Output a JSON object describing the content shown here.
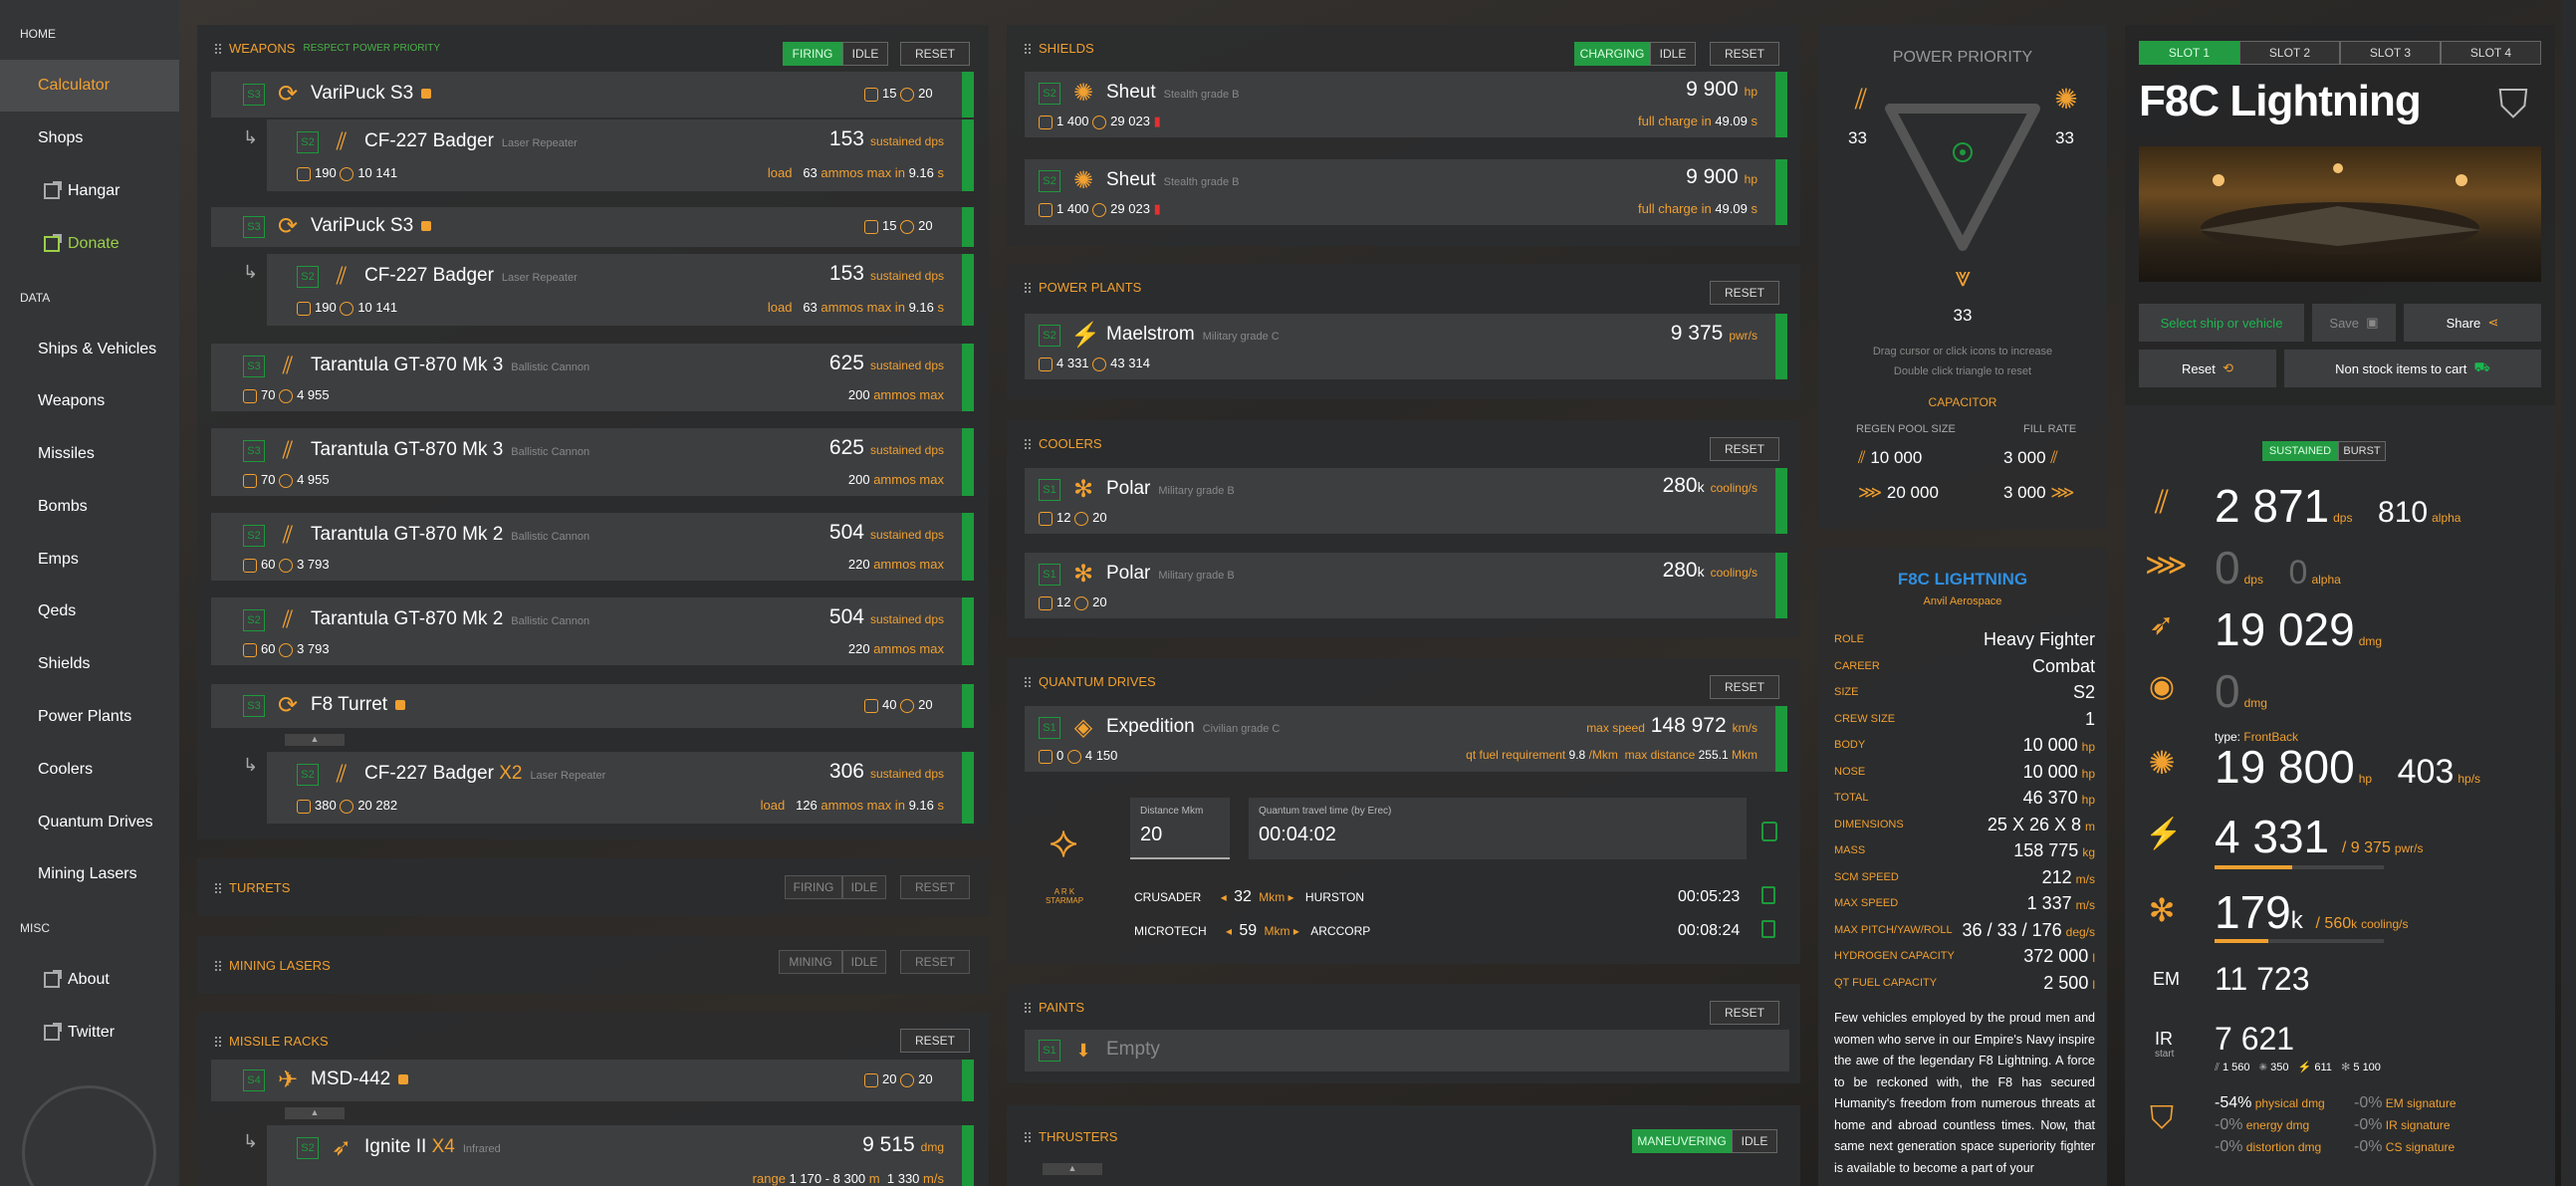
{
  "sidebar": {
    "home_section": "HOME",
    "data_section": "DATA",
    "misc_section": "MISC",
    "items": [
      {
        "label": "Calculator"
      },
      {
        "label": "Shops"
      },
      {
        "label": "Hangar"
      },
      {
        "label": "Donate"
      },
      {
        "label": "Ships & Vehicles"
      },
      {
        "label": "Weapons"
      },
      {
        "label": "Missiles"
      },
      {
        "label": "Bombs"
      },
      {
        "label": "Emps"
      },
      {
        "label": "Qeds"
      },
      {
        "label": "Shields"
      },
      {
        "label": "Power Plants"
      },
      {
        "label": "Coolers"
      },
      {
        "label": "Quantum Drives"
      },
      {
        "label": "Mining Lasers"
      },
      {
        "label": "About"
      },
      {
        "label": "Twitter"
      }
    ]
  },
  "weapons": {
    "title": "WEAPONS",
    "subtitle": "RESPECT POWER PRIORITY",
    "firing": "FIRING",
    "idle": "IDLE",
    "reset": "RESET",
    "rows": [
      {
        "slot": "S3",
        "name": "VariPuck S3",
        "type": "",
        "p1": "15",
        "p2": "20"
      },
      {
        "slot": "S2",
        "name": "CF-227 Badger",
        "type": "Laser Repeater",
        "value": "153",
        "unit": "sustained dps",
        "p1": "190",
        "p2": "10 141",
        "sub_a": "load",
        "sub_b": "63",
        "sub_c": "ammos max in",
        "sub_d": "9.16",
        "sub_e": "s"
      },
      {
        "slot": "S3",
        "name": "VariPuck S3",
        "type": "",
        "p1": "15",
        "p2": "20"
      },
      {
        "slot": "S2",
        "name": "CF-227 Badger",
        "type": "Laser Repeater",
        "value": "153",
        "unit": "sustained dps",
        "p1": "190",
        "p2": "10 141",
        "sub_a": "load",
        "sub_b": "63",
        "sub_c": "ammos max in",
        "sub_d": "9.16",
        "sub_e": "s"
      },
      {
        "slot": "S3",
        "name": "Tarantula GT-870 Mk 3",
        "type": "Ballistic Cannon",
        "value": "625",
        "unit": "sustained dps",
        "p1": "70",
        "p2": "4 955",
        "sub_b": "200",
        "sub_c": "ammos max"
      },
      {
        "slot": "S3",
        "name": "Tarantula GT-870 Mk 3",
        "type": "Ballistic Cannon",
        "value": "625",
        "unit": "sustained dps",
        "p1": "70",
        "p2": "4 955",
        "sub_b": "200",
        "sub_c": "ammos max"
      },
      {
        "slot": "S2",
        "name": "Tarantula GT-870 Mk 2",
        "type": "Ballistic Cannon",
        "value": "504",
        "unit": "sustained dps",
        "p1": "60",
        "p2": "3 793",
        "sub_b": "220",
        "sub_c": "ammos max"
      },
      {
        "slot": "S2",
        "name": "Tarantula GT-870 Mk 2",
        "type": "Ballistic Cannon",
        "value": "504",
        "unit": "sustained dps",
        "p1": "60",
        "p2": "3 793",
        "sub_b": "220",
        "sub_c": "ammos max"
      },
      {
        "slot": "S3",
        "name": "F8 Turret",
        "type": "",
        "p1": "40",
        "p2": "20"
      },
      {
        "slot": "S2",
        "name": "CF-227 Badger",
        "mult": "X2",
        "type": "Laser Repeater",
        "value": "306",
        "unit": "sustained dps",
        "p1": "380",
        "p2": "20 282",
        "sub_a": "load",
        "sub_b": "126",
        "sub_c": "ammos max in",
        "sub_d": "9.16",
        "sub_e": "s"
      }
    ]
  },
  "turrets": {
    "title": "TURRETS",
    "firing": "FIRING",
    "idle": "IDLE",
    "reset": "RESET"
  },
  "mining": {
    "title": "MINING LASERS",
    "mining": "MINING",
    "idle": "IDLE",
    "reset": "RESET"
  },
  "missiles": {
    "title": "MISSILE RACKS",
    "reset": "RESET",
    "rack": {
      "slot": "S4",
      "name": "MSD-442",
      "p1": "20",
      "p2": "20"
    },
    "missile": {
      "slot": "S2",
      "name": "Ignite II",
      "mult": "X4",
      "type": "Infrared",
      "value": "9 515",
      "unit": "dmg",
      "range_lbl": "range",
      "range": "1 170 - 8 300",
      "range_u": "m",
      "speed": "1 330",
      "speed_u": "m/s"
    }
  },
  "shields": {
    "title": "SHIELDS",
    "charging": "CHARGING",
    "idle": "IDLE",
    "reset": "RESET",
    "rows": [
      {
        "slot": "S2",
        "name": "Sheut",
        "type": "Stealth grade B",
        "value": "9 900",
        "unit": "hp",
        "p1": "1 400",
        "p2": "29 023",
        "sub_a": "full charge in",
        "sub_b": "49.09",
        "sub_c": "s"
      },
      {
        "slot": "S2",
        "name": "Sheut",
        "type": "Stealth grade B",
        "value": "9 900",
        "unit": "hp",
        "p1": "1 400",
        "p2": "29 023",
        "sub_a": "full charge in",
        "sub_b": "49.09",
        "sub_c": "s"
      }
    ]
  },
  "power_plants": {
    "title": "POWER PLANTS",
    "reset": "RESET",
    "row": {
      "slot": "S2",
      "name": "Maelstrom",
      "type": "Military grade C",
      "value": "9 375",
      "unit": "pwr/s",
      "p1": "4 331",
      "p2": "43 314"
    }
  },
  "coolers": {
    "title": "COOLERS",
    "reset": "RESET",
    "rows": [
      {
        "slot": "S1",
        "name": "Polar",
        "type": "Military grade B",
        "value": "280",
        "vk": "k",
        "unit": "cooling/s",
        "p1": "12",
        "p2": "20"
      },
      {
        "slot": "S1",
        "name": "Polar",
        "type": "Military grade B",
        "value": "280",
        "vk": "k",
        "unit": "cooling/s",
        "p1": "12",
        "p2": "20"
      }
    ]
  },
  "quantum": {
    "title": "QUANTUM DRIVES",
    "reset": "RESET",
    "row": {
      "slot": "S1",
      "name": "Expedition",
      "type": "Civilian grade C",
      "max_speed_lbl": "max speed",
      "max_speed": "148 972",
      "max_speed_u": "km/s",
      "p1": "0",
      "p2": "4 150",
      "fuel_lbl": "qt fuel requirement",
      "fuel": "9.8",
      "fuel_u": "/Mkm",
      "dist_lbl": "max distance",
      "dist": "255.1",
      "dist_u": "Mkm"
    },
    "distance_label": "Distance Mkm",
    "distance_value": "20",
    "travel_label": "Quantum travel time (by Erec)",
    "travel_value": "00:04:02",
    "logo_text": "A R K\nSTARMAP",
    "routes": [
      {
        "from": "CRUSADER",
        "dist": "32",
        "unit": "Mkm",
        "to": "HURSTON",
        "time": "00:05:23"
      },
      {
        "from": "MICROTECH",
        "dist": "59",
        "unit": "Mkm",
        "to": "ARCCORP",
        "time": "00:08:24"
      }
    ]
  },
  "paints": {
    "title": "PAINTS",
    "reset": "RESET",
    "row": {
      "slot": "S1",
      "name": "Empty"
    }
  },
  "thrusters": {
    "title": "THRUSTERS",
    "maneuvering": "MANEUVERING",
    "idle": "IDLE"
  },
  "power_priority": {
    "title": "POWER PRIORITY",
    "weapons": "33",
    "shields": "33",
    "engines": "33",
    "hint1": "Drag cursor or click icons to increase",
    "hint2": "Double click triangle to reset",
    "capacitor": "CAPACITOR",
    "regen_lbl": "REGEN POOL SIZE",
    "fill_lbl": "FILL RATE",
    "cap_rows": [
      {
        "regen": "10 000",
        "fill": "3 000"
      },
      {
        "regen": "20 000",
        "fill": "3 000"
      }
    ]
  },
  "ship_info": {
    "name": "F8C LIGHTNING",
    "maker": "Anvil Aerospace",
    "stats": [
      {
        "label": "ROLE",
        "value": "Heavy Fighter",
        "unit": ""
      },
      {
        "label": "CAREER",
        "value": "Combat",
        "unit": ""
      },
      {
        "label": "SIZE",
        "value": "S2",
        "unit": ""
      },
      {
        "label": "CREW SIZE",
        "value": "1",
        "unit": ""
      },
      {
        "label": "BODY",
        "value": "10 000",
        "unit": "hp"
      },
      {
        "label": "NOSE",
        "value": "10 000",
        "unit": "hp"
      },
      {
        "label": "TOTAL",
        "value": "46 370",
        "unit": "hp"
      },
      {
        "label": "DIMENSIONS",
        "value": "25 X 26 X 8",
        "unit": "m"
      },
      {
        "label": "MASS",
        "value": "158 775",
        "unit": "kg"
      },
      {
        "label": "SCM SPEED",
        "value": "212",
        "unit": "m/s"
      },
      {
        "label": "MAX SPEED",
        "value": "1 337",
        "unit": "m/s"
      },
      {
        "label": "MAX PITCH/YAW/ROLL",
        "value": "36 / 33 / 176",
        "unit": "deg/s"
      },
      {
        "label": "HYDROGEN CAPACITY",
        "value": "372 000",
        "unit": "l"
      },
      {
        "label": "QT FUEL CAPACITY",
        "value": "2 500",
        "unit": "l"
      }
    ],
    "description": "Few vehicles employed by the proud men and women who serve in our Empire's Navy inspire the awe of the legendary F8 Lightning. A force to be reckoned with, the F8 has secured Humanity's freedom from numerous threats at home and abroad countless times. Now, that same next generation space superiority fighter is available to become a part of your"
  },
  "ship_panel": {
    "slots": [
      "SLOT 1",
      "SLOT 2",
      "SLOT 3",
      "SLOT 4"
    ],
    "title": "F8C Lightning",
    "select": "Select ship or vehicle",
    "save": "Save",
    "share": "Share",
    "reset": "Reset",
    "nonstock": "Non stock items to cart",
    "sustained": "SUSTAINED",
    "burst": "BURST",
    "dps": "2 871",
    "dps_u": "dps",
    "alpha": "810",
    "alpha_u": "alpha",
    "missile_dps": "0",
    "missile_dps_u": "dps",
    "missile_alpha": "0",
    "missile_alpha_u": "alpha",
    "missile_dmg": "19 029",
    "missile_dmg_u": "dmg",
    "emp_dmg": "0",
    "emp_dmg_u": "dmg",
    "shield_type_lbl": "type:",
    "shield_type": "FrontBack",
    "shield_hp": "19 800",
    "shield_hp_u": "hp",
    "shield_regen": "403",
    "shield_regen_u": "hp/s",
    "power_use": "4 331",
    "power_total": "/ 9 375",
    "power_u": "pwr/s",
    "power_fill": 0.46,
    "cool_use": "179",
    "cool_k": "k",
    "cool_total": "/ 560",
    "cool_k2": "k",
    "cool_u": "cooling/s",
    "cool_fill": 0.32,
    "em_lbl": "EM",
    "em": "11 723",
    "ir_lbl": "IR",
    "ir_sub": "start",
    "ir": "7 621",
    "ir_a": "1 560",
    "ir_b": "350",
    "ir_c": "611",
    "ir_d": "5 100",
    "res": [
      {
        "pct": "-54%",
        "label": "physical dmg"
      },
      {
        "pct": "-0%",
        "label": "energy dmg"
      },
      {
        "pct": "-0%",
        "label": "distortion dmg"
      }
    ],
    "sig": [
      {
        "pct": "-0%",
        "label": "EM signature"
      },
      {
        "pct": "-0%",
        "label": "IR signature"
      },
      {
        "pct": "-0%",
        "label": "CS signature"
      }
    ]
  }
}
